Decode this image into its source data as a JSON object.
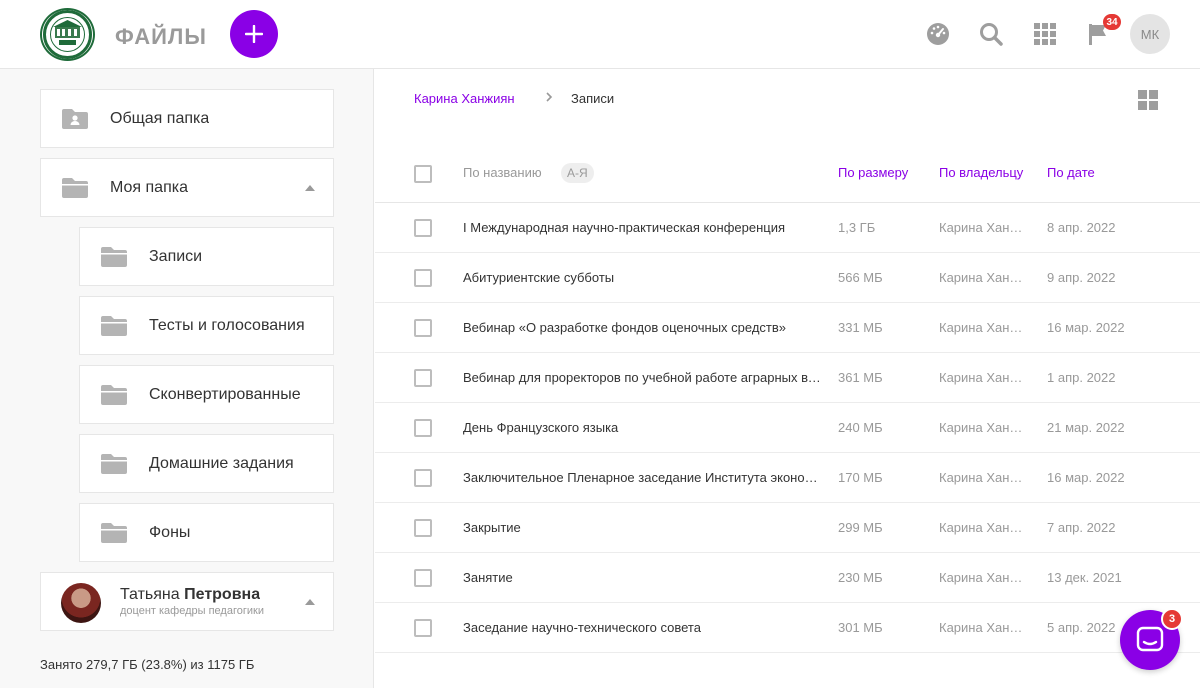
{
  "header": {
    "app_title": "ФАЙЛЫ",
    "add_icon": "plus-icon",
    "icons": [
      "dashboard-icon",
      "search-icon",
      "apps-grid-icon",
      "flag-icon"
    ],
    "notifications_count": "34",
    "user_initials": "МК"
  },
  "sidebar": {
    "shared_folder": "Общая папка",
    "my_folder": "Моя папка",
    "subfolders": [
      {
        "label": "Записи"
      },
      {
        "label": "Тесты и голосования"
      },
      {
        "label": "Сконвертированные"
      },
      {
        "label": "Домашние задания"
      },
      {
        "label": "Фоны"
      }
    ],
    "user": {
      "first_name": "Татьяна",
      "patronymic": "Петровна",
      "role": "доцент кафедры педагогики"
    },
    "storage": "Занято 279,7 ГБ (23.8%) из 1175 ГБ"
  },
  "main": {
    "breadcrumb": {
      "parent": "Карина Ханжиян",
      "separator": ">",
      "current": "Записи"
    },
    "columns": {
      "name": "По названию",
      "sort_az": "А-Я",
      "size": "По размеру",
      "owner": "По владельцу",
      "date": "По дате"
    },
    "files": [
      {
        "name": "I Международная научно-практическая конференция",
        "size": "1,3 ГБ",
        "owner": "Карина Ханжиян",
        "date": "8 апр. 2022"
      },
      {
        "name": "Абитуриентские субботы",
        "size": "566 МБ",
        "owner": "Карина Ханжиян",
        "date": "9 апр. 2022"
      },
      {
        "name": "Вебинар «О разработке фондов оценочных средств»",
        "size": "331 МБ",
        "owner": "Карина Ханжиян",
        "date": "16 мар. 2022"
      },
      {
        "name": "Вебинар для проректоров по учебной работе аграрных вузов",
        "size": "361 МБ",
        "owner": "Карина Ханжиян",
        "date": "1 апр. 2022"
      },
      {
        "name": "День Французского языка",
        "size": "240 МБ",
        "owner": "Карина Ханжиян",
        "date": "21 мар. 2022"
      },
      {
        "name": "Заключительное Пленарное заседание Института экономики",
        "size": "170 МБ",
        "owner": "Карина Ханжиян",
        "date": "16 мар. 2022"
      },
      {
        "name": "Закрытие",
        "size": "299 МБ",
        "owner": "Карина Ханжиян",
        "date": "7 апр. 2022"
      },
      {
        "name": "Занятие",
        "size": "230 МБ",
        "owner": "Карина Ханжиян",
        "date": "13 дек. 2021"
      },
      {
        "name": "Заседание научно-технического совета",
        "size": "301 МБ",
        "owner": "Карина Ханжиян",
        "date": "5 апр. 2022"
      }
    ]
  },
  "chat": {
    "icon": "chat-icon",
    "unread": "3"
  },
  "colors": {
    "accent": "#8a00e6",
    "badge": "#e53935"
  }
}
